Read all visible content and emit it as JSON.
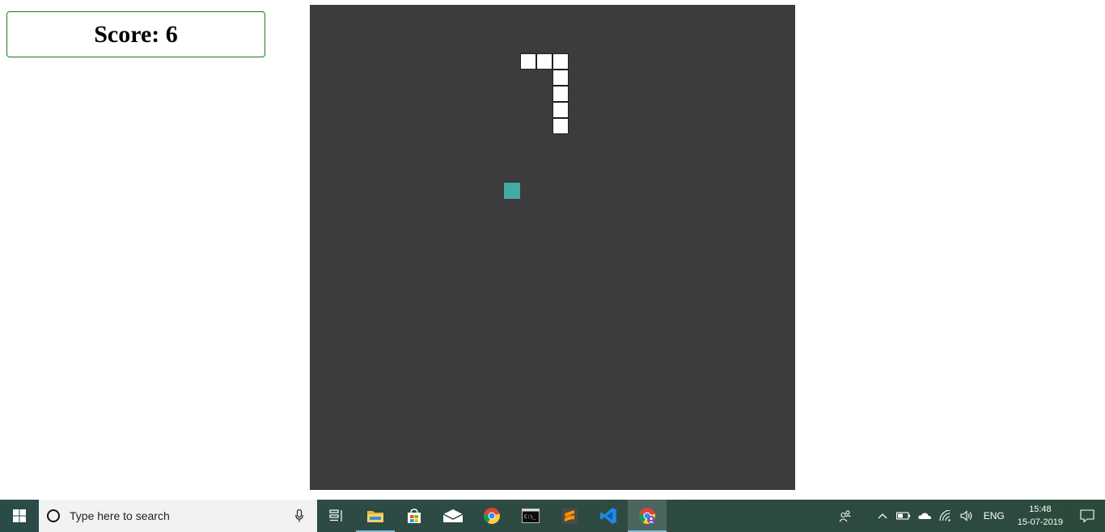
{
  "score": {
    "label": "Score: 6"
  },
  "game": {
    "grid_cell": 20,
    "board_color": "#3c3c3c",
    "snake_color": "#ffffff",
    "food_color": "#45a9a5",
    "snake_cells": [
      [
        13,
        3
      ],
      [
        14,
        3
      ],
      [
        15,
        3
      ],
      [
        15,
        4
      ],
      [
        15,
        5
      ],
      [
        15,
        6
      ],
      [
        15,
        7
      ]
    ],
    "food_cell": [
      12,
      11
    ]
  },
  "taskbar": {
    "search_placeholder": "Type here to search",
    "pinned": [
      {
        "name": "task-view-icon"
      },
      {
        "name": "file-explorer-icon"
      },
      {
        "name": "microsoft-store-icon"
      },
      {
        "name": "mail-icon"
      },
      {
        "name": "chrome-icon"
      },
      {
        "name": "terminal-icon"
      },
      {
        "name": "sublime-text-icon"
      },
      {
        "name": "vscode-icon"
      },
      {
        "name": "chrome-profile-icon"
      }
    ],
    "language": "ENG",
    "time": "15:48",
    "date": "15-07-2019"
  }
}
